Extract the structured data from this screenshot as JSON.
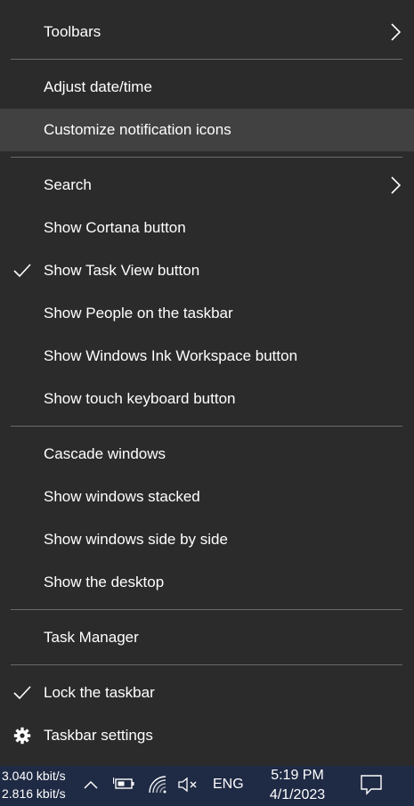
{
  "menu": {
    "items": [
      {
        "label": "Toolbars"
      },
      {
        "label": "Adjust date/time"
      },
      {
        "label": "Customize notification icons"
      },
      {
        "label": "Search"
      },
      {
        "label": "Show Cortana button"
      },
      {
        "label": "Show Task View button"
      },
      {
        "label": "Show People on the taskbar"
      },
      {
        "label": "Show Windows Ink Workspace button"
      },
      {
        "label": "Show touch keyboard button"
      },
      {
        "label": "Cascade windows"
      },
      {
        "label": "Show windows stacked"
      },
      {
        "label": "Show windows side by side"
      },
      {
        "label": "Show the desktop"
      },
      {
        "label": "Task Manager"
      },
      {
        "label": "Lock the taskbar"
      },
      {
        "label": "Taskbar settings"
      }
    ]
  },
  "taskbar": {
    "upload_speed": "3.040 kbit/s",
    "download_speed": "2.816 kbit/s",
    "language": "ENG",
    "time": "5:19 PM",
    "date": "4/1/2023"
  },
  "colors": {
    "menu_background": "#2b2b2b",
    "hover_background": "#414141",
    "separator": "#6a6a6a",
    "taskbar_background": "#1f2a44",
    "text": "#ffffff"
  },
  "icons": {
    "submenu": "chevron-right-icon",
    "checked": "checkmark-icon",
    "settings": "gear-icon",
    "tray": [
      "chevron-up-icon",
      "battery-icon",
      "wifi-icon",
      "volume-muted-icon",
      "notification-icon"
    ]
  }
}
